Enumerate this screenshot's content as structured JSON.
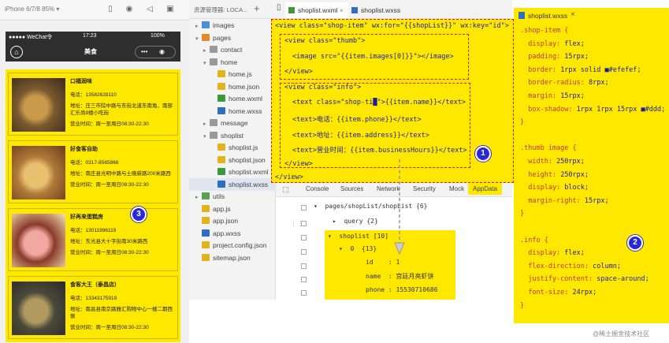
{
  "simulator": {
    "device": "iPhone 6/7/8 85% ▾",
    "status": {
      "carrier": "●●●●● WeChat令",
      "time": "17:23",
      "battery": "100%"
    },
    "nav_title": "美食",
    "shops": [
      {
        "name": "口福润味",
        "phone": "电话：13582628110",
        "address": "地址：庄三市院中路与东街北道东南角，南部汇乐尚8楼小吃街",
        "hours": "营业时间：周一至周日08:30-22:30"
      },
      {
        "name": "好食客自助",
        "phone": "电话：0317-8565866",
        "address": "地址：南庄县光明中路与土晚新路200米路西",
        "hours": "营业时间：周一至周日08:30-22:30"
      },
      {
        "name": "好再来蛋糕房",
        "phone": "电话：13011996119",
        "address": "地址：东光县大十字街南30米路西",
        "hours": "营业时间：周一至周日08:30-22:30"
      },
      {
        "name": "食客大王（泰昌店）",
        "phone": "电话：13343175919",
        "address": "地址：南昌县南京路雅汇购物中心一楼二期西侧",
        "hours": "营业时间：周一至周日08:30-22:30"
      }
    ]
  },
  "explorer": {
    "title": "资源管理器: LOCA...",
    "items": [
      {
        "label": "images",
        "indent": 0,
        "type": "folder-blue",
        "arrow": "▸"
      },
      {
        "label": "pages",
        "indent": 0,
        "type": "folder-orange",
        "arrow": "▾"
      },
      {
        "label": "contact",
        "indent": 1,
        "type": "folder-gray",
        "arrow": "▸"
      },
      {
        "label": "home",
        "indent": 1,
        "type": "folder-gray",
        "arrow": "▾"
      },
      {
        "label": "home.js",
        "indent": 2,
        "type": "js",
        "arrow": ""
      },
      {
        "label": "home.json",
        "indent": 2,
        "type": "json",
        "arrow": ""
      },
      {
        "label": "home.wxml",
        "indent": 2,
        "type": "wxml",
        "arrow": ""
      },
      {
        "label": "home.wxss",
        "indent": 2,
        "type": "wxss",
        "arrow": ""
      },
      {
        "label": "message",
        "indent": 1,
        "type": "folder-gray",
        "arrow": "▸"
      },
      {
        "label": "shoplist",
        "indent": 1,
        "type": "folder-gray",
        "arrow": "▾"
      },
      {
        "label": "shoplist.js",
        "indent": 2,
        "type": "js",
        "arrow": ""
      },
      {
        "label": "shoplist.json",
        "indent": 2,
        "type": "json",
        "arrow": ""
      },
      {
        "label": "shoplist.wxml",
        "indent": 2,
        "type": "wxml",
        "arrow": ""
      },
      {
        "label": "shoplist.wxss",
        "indent": 2,
        "type": "wxss",
        "arrow": "",
        "selected": true
      },
      {
        "label": "utils",
        "indent": 0,
        "type": "folder-green",
        "arrow": "▸"
      },
      {
        "label": "app.js",
        "indent": 0,
        "type": "js",
        "arrow": ""
      },
      {
        "label": "app.json",
        "indent": 0,
        "type": "json",
        "arrow": ""
      },
      {
        "label": "app.wxss",
        "indent": 0,
        "type": "wxss",
        "arrow": ""
      },
      {
        "label": "project.config.json",
        "indent": 0,
        "type": "json",
        "arrow": ""
      },
      {
        "label": "sitemap.json",
        "indent": 0,
        "type": "json",
        "arrow": ""
      }
    ]
  },
  "editor_tabs": [
    "shoplist.wxml",
    "shoplist.wxss"
  ],
  "wxml": {
    "l1": "<view class=\"shop-item\" wx:for=\"{{shopList}}\" wx:key=\"id\">",
    "l2": "<view class=\"thumb\">",
    "l3": "<image src=\"{{item.images[0]}}\"></image>",
    "l4": "</view>",
    "l5": "<view class=\"info\">",
    "l6": "<text class=\"shop-ti█\">{{item.name}}</text>",
    "l7": "<text>电话：{{item.phone}}</text>",
    "l8": "<text>地址：{{item.address}}</text>",
    "l9": "<text>营业时间：{{item.businessHours}}</text>",
    "l10": "</view>",
    "l11": "</view>"
  },
  "console_tabs": [
    "Console",
    "Sources",
    "Network",
    "Security",
    "Mock",
    "AppData"
  ],
  "appdata": {
    "root": "▾  pages/shopList/shopList {6}",
    "query": "▸  query {2}",
    "shoplist": "▾  shoplist [10]",
    "item0": "▾  0  {13}",
    "id": "id    : 1",
    "name": "name  : 宫廷月亮虾饼",
    "phone": "phone : 15530710686"
  },
  "wxss_tab": "shoplist.wxss",
  "wxss": [
    {
      "t": ".shop-item {"
    },
    {
      "t": "  display: ",
      "v": "flex;"
    },
    {
      "t": "  padding: ",
      "v": "15rpx;"
    },
    {
      "t": "  border: ",
      "v": "1rpx solid ■#efefef;"
    },
    {
      "t": "  border-radius: ",
      "v": "8rpx;"
    },
    {
      "t": "  margin: ",
      "v": "15rpx;"
    },
    {
      "t": "  box-shadow: ",
      "v": "1rpx 1rpx 15rpx ■#ddd;"
    },
    {
      "t": "}"
    },
    {
      "t": ""
    },
    {
      "t": ".thumb image {"
    },
    {
      "t": "  width: ",
      "v": "250rpx;"
    },
    {
      "t": "  height: ",
      "v": "250rpx;"
    },
    {
      "t": "  display: ",
      "v": "block;"
    },
    {
      "t": "  margin-right: ",
      "v": "15rpx;"
    },
    {
      "t": "}"
    },
    {
      "t": ""
    },
    {
      "t": ".info {"
    },
    {
      "t": "  display: ",
      "v": "flex;"
    },
    {
      "t": "  flex-direction: ",
      "v": "column;"
    },
    {
      "t": "  justify-content: ",
      "v": "space-around;"
    },
    {
      "t": "  font-size: ",
      "v": "24rpx;"
    },
    {
      "t": "}"
    }
  ],
  "badges": [
    "1",
    "2",
    "3"
  ],
  "watermark": "@稀土掘金技术社区"
}
